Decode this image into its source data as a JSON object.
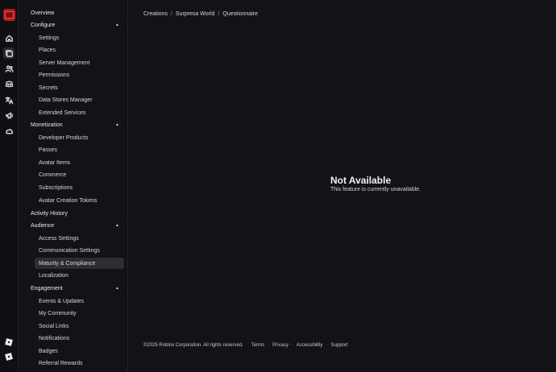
{
  "breadcrumb": [
    "Creations",
    "Surpresa World",
    "Questionnaire"
  ],
  "breadcrumb_separator": "/",
  "sidebar": {
    "overview": "Overview",
    "configure": {
      "label": "Configure",
      "items": [
        "Settings",
        "Places",
        "Server Management",
        "Permissions",
        "Secrets",
        "Data Stores Manager",
        "Extended Services"
      ]
    },
    "monetization": {
      "label": "Monetization",
      "items": [
        "Developer Products",
        "Passes",
        "Avatar Items",
        "Commerce",
        "Subscriptions",
        "Avatar Creation Tokens"
      ]
    },
    "activity_history": "Activity History",
    "audience": {
      "label": "Audience",
      "items": [
        "Access Settings",
        "Communication Settings",
        "Maturity & Compliance",
        "Localization"
      ]
    },
    "engagement": {
      "label": "Engagement",
      "items": [
        "Events & Updates",
        "My Community",
        "Social Links",
        "Notifications",
        "Badges",
        "Referral Rewards"
      ]
    },
    "selected": "Maturity & Compliance"
  },
  "main": {
    "title": "Not Available",
    "description": "This feature is currently unavailable."
  },
  "footer": {
    "copyright": "©2025 Roblox Corporation. All rights reserved.",
    "links": [
      "Terms",
      "Privacy",
      "Accessibility",
      "Support"
    ],
    "separator": "·"
  },
  "rail_icons": [
    "home-icon",
    "creations-icon",
    "people-icon",
    "discord-icon",
    "translate-icon",
    "megaphone-icon",
    "cloud-icon"
  ],
  "colors": {
    "background": "#121316",
    "selected": "#2c2e33",
    "logo": "#b8171c"
  }
}
